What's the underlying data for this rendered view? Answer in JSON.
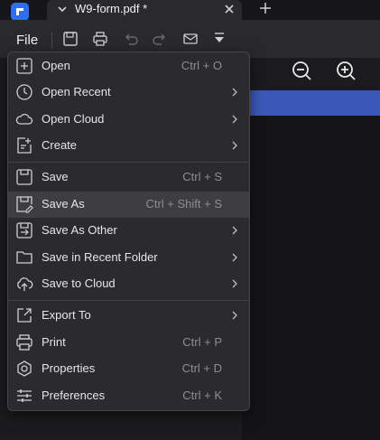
{
  "tab": {
    "title": "W9-form.pdf *"
  },
  "toolbar": {
    "file_label": "File"
  },
  "menu": {
    "items": [
      {
        "label": "Open",
        "shortcut": "Ctrl + O"
      },
      {
        "label": "Open Recent"
      },
      {
        "label": "Open Cloud"
      },
      {
        "label": "Create"
      },
      {
        "label": "Save",
        "shortcut": "Ctrl + S"
      },
      {
        "label": "Save As",
        "shortcut": "Ctrl + Shift + S"
      },
      {
        "label": "Save As Other"
      },
      {
        "label": "Save in Recent Folder"
      },
      {
        "label": "Save to Cloud"
      },
      {
        "label": "Export To"
      },
      {
        "label": "Print",
        "shortcut": "Ctrl + P"
      },
      {
        "label": "Properties",
        "shortcut": "Ctrl + D"
      },
      {
        "label": "Preferences",
        "shortcut": "Ctrl + K"
      }
    ]
  }
}
